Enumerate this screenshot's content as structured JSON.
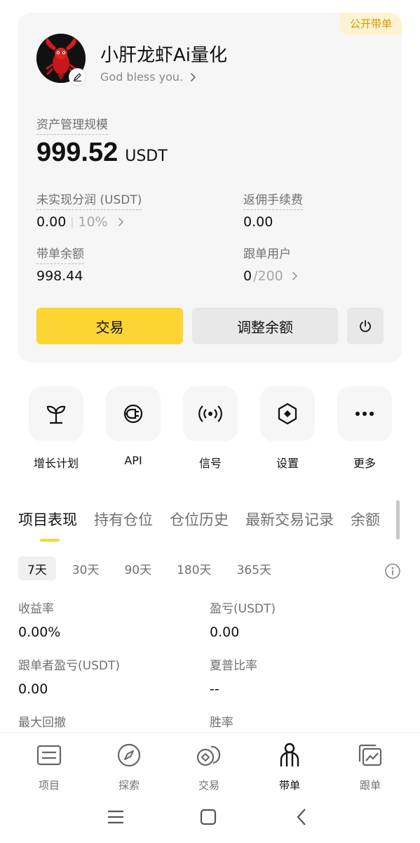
{
  "profile": {
    "badge": "公开带单",
    "name": "小肝龙虾Ai量化",
    "bio": "God bless you.",
    "avatar_icon": "lobster-avatar",
    "edit_icon": "pencil-icon"
  },
  "assets": {
    "label": "资产管理规模",
    "value": "999.52",
    "unit": "USDT"
  },
  "stats": {
    "unrealized_label": "未实现分润 (USDT)",
    "unrealized_value": "0.00",
    "unrealized_percent": "10%",
    "rebate_label": "返佣手续费",
    "rebate_value": "0.00",
    "balance_label": "带单余额",
    "balance_value": "998.44",
    "followers_label": "跟单用户",
    "followers_value": "0",
    "followers_max": "/200"
  },
  "buttons": {
    "trade": "交易",
    "adjust": "调整余额",
    "power_icon": "power-icon"
  },
  "quick_actions": [
    {
      "label": "增长计划",
      "icon": "sprout-icon"
    },
    {
      "label": "API",
      "icon": "plug-icon"
    },
    {
      "label": "信号",
      "icon": "signal-icon"
    },
    {
      "label": "设置",
      "icon": "settings-hexagon-icon"
    },
    {
      "label": "更多",
      "icon": "more-icon"
    }
  ],
  "tabs": [
    "项目表现",
    "持有仓位",
    "仓位历史",
    "最新交易记录",
    "余额"
  ],
  "active_tab": "项目表现",
  "periods": [
    "7天",
    "30天",
    "90天",
    "180天",
    "365天"
  ],
  "active_period": "7天",
  "metrics": {
    "roi_label": "收益率",
    "roi_value": "0.00%",
    "pnl_label": "盈亏(USDT)",
    "pnl_value": "0.00",
    "follower_pnl_label": "跟单者盈亏(USDT)",
    "follower_pnl_value": "0.00",
    "sharpe_label": "夏普比率",
    "sharpe_value": "--",
    "max_drawdown_label": "最大回撤",
    "win_rate_label": "胜率"
  },
  "bottom_nav": [
    {
      "label": "项目",
      "icon": "list-icon"
    },
    {
      "label": "探索",
      "icon": "compass-icon"
    },
    {
      "label": "交易",
      "icon": "exchange-icon"
    },
    {
      "label": "带单",
      "icon": "trader-icon"
    },
    {
      "label": "跟单",
      "icon": "copy-chart-icon"
    }
  ],
  "active_nav": "带单",
  "colors": {
    "accent": "#fcd535",
    "badge_text": "#d19b00",
    "badge_bg": "#fdf3d2",
    "muted": "#707070"
  }
}
